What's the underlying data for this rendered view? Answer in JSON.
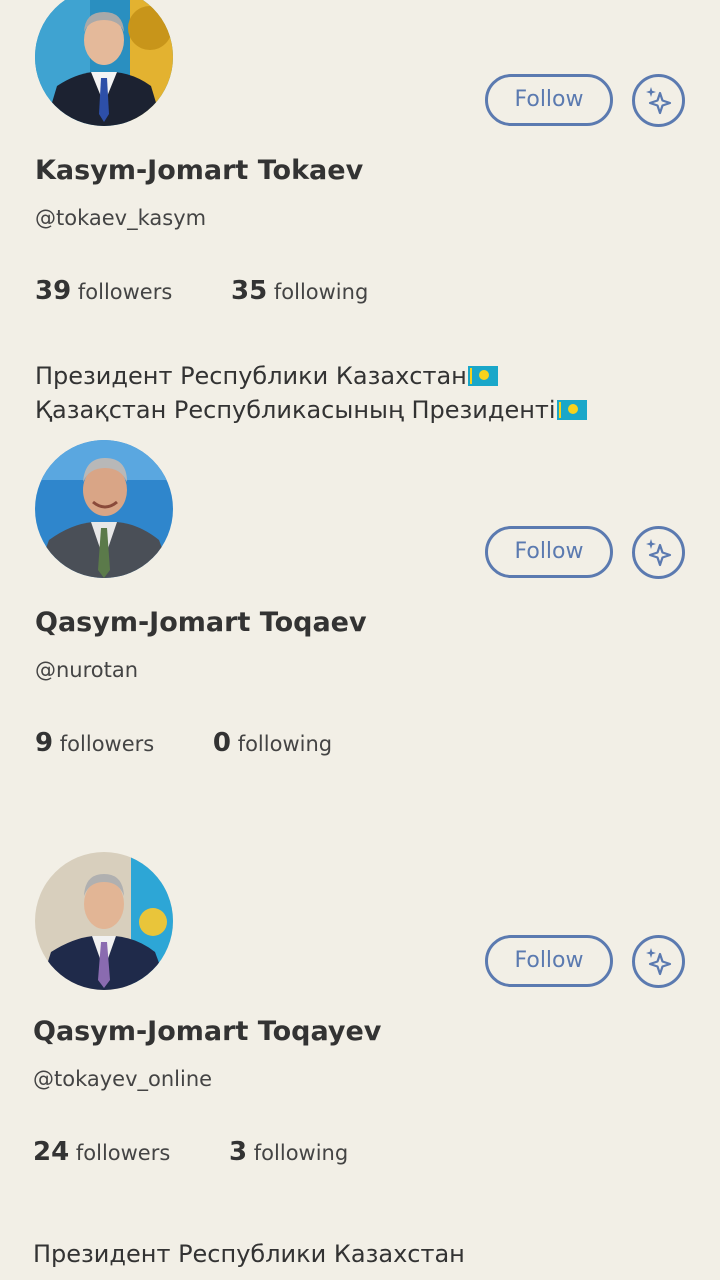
{
  "profiles": [
    {
      "name": "Kasym-Jomart Tokaev",
      "handle": "@tokaev_kasym",
      "followers_count": "39",
      "followers_label": "followers",
      "following_count": "35",
      "following_label": "following",
      "follow_label": "Follow",
      "bio": [
        "Президент Республики Казахстан",
        "Қазақстан Республикасының Президенті"
      ]
    },
    {
      "name": "Qasym-Jomart Toqaev",
      "handle": "@nurotan",
      "followers_count": "9",
      "followers_label": "followers",
      "following_count": "0",
      "following_label": "following",
      "follow_label": "Follow"
    },
    {
      "name": "Qasym-Jomart Toqayev",
      "handle": "@tokayev_online",
      "followers_count": "24",
      "followers_label": "followers",
      "following_count": "3",
      "following_label": "following",
      "follow_label": "Follow",
      "bio": [
        "Президент Республики Казахстан"
      ]
    }
  ],
  "colors": {
    "background": "#f2efe6",
    "accent": "#5b7ab0",
    "text": "#333333"
  },
  "icons": {
    "sparkle": "sparkle-icon",
    "flag": "kazakhstan-flag-icon"
  }
}
